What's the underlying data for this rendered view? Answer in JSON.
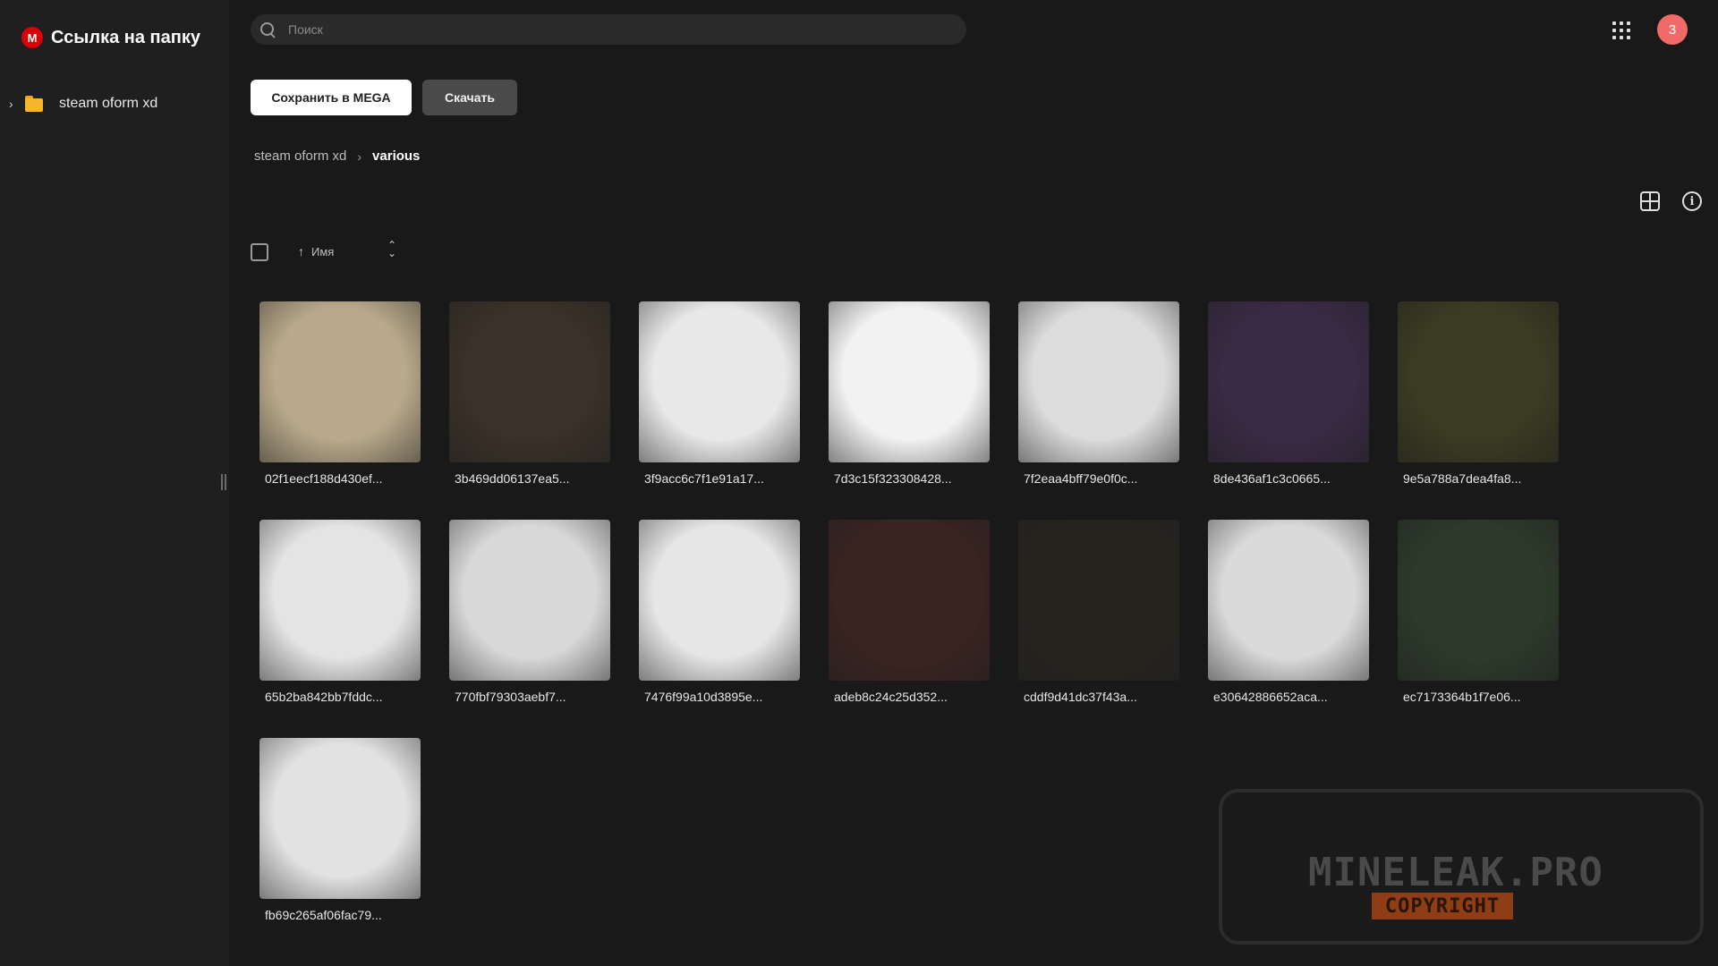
{
  "app": {
    "logo_letter": "M",
    "title": "Ссылка на папку"
  },
  "sidebar": {
    "tree": [
      {
        "label": "steam oform xd"
      }
    ]
  },
  "search": {
    "placeholder": "Поиск"
  },
  "user": {
    "avatar_text": "3",
    "avatar_color": "#f06a6a"
  },
  "actions": {
    "save_label": "Сохранить в MEGA",
    "download_label": "Скачать"
  },
  "breadcrumb": {
    "parent": "steam oform xd",
    "current": "various"
  },
  "sort": {
    "column_label": "Имя"
  },
  "files": [
    {
      "name": "02f1eecf188d430ef...",
      "tone": "#b8a98a"
    },
    {
      "name": "3b469dd06137ea5...",
      "tone": "#3a3128"
    },
    {
      "name": "3f9acc6c7f1e91a17...",
      "tone": "#e8e8e8"
    },
    {
      "name": "7d3c15f323308428...",
      "tone": "#f2f2f2"
    },
    {
      "name": "7f2eaa4bff79e0f0c...",
      "tone": "#dcdcdc"
    },
    {
      "name": "8de436af1c3c0665...",
      "tone": "#3a2a44"
    },
    {
      "name": "9e5a788a7dea4fa8...",
      "tone": "#3b3a22"
    },
    {
      "name": "65b2ba842bb7fddc...",
      "tone": "#e4e4e4"
    },
    {
      "name": "770fbf79303aebf7...",
      "tone": "#d8d8d8"
    },
    {
      "name": "7476f99a10d3895e...",
      "tone": "#e6e6e6"
    },
    {
      "name": "adeb8c24c25d352...",
      "tone": "#3a2420"
    },
    {
      "name": "cddf9d41dc37f43a...",
      "tone": "#26241e"
    },
    {
      "name": "e30642886652aca...",
      "tone": "#dadada"
    },
    {
      "name": "ec7173364b1f7e06...",
      "tone": "#2c3a2a"
    },
    {
      "name": "fb69c265af06fac79...",
      "tone": "#e2e2e2"
    }
  ],
  "watermark": {
    "text": "MINELEAK.PRO",
    "badge": "COPYRIGHT"
  }
}
